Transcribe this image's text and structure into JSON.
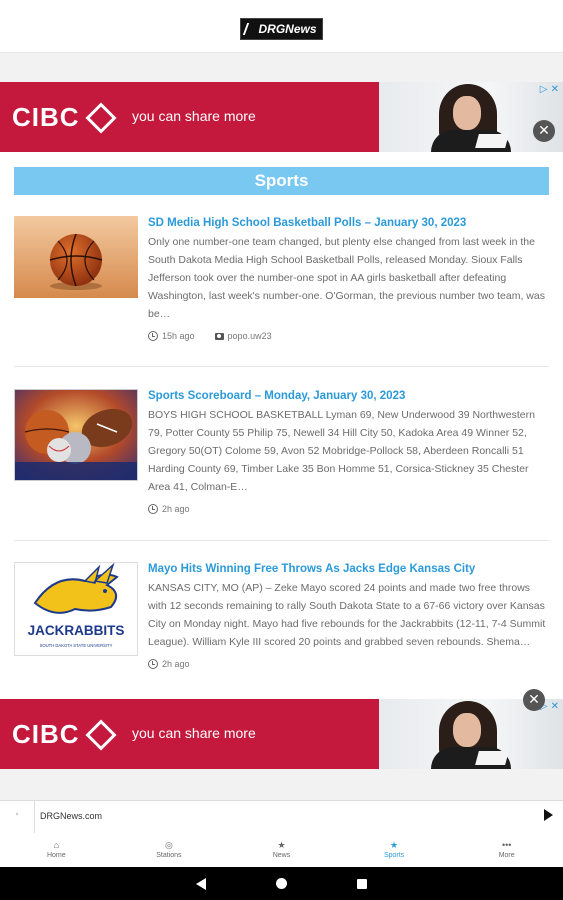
{
  "header": {
    "logo_text": "DRGNews"
  },
  "ads": {
    "brand": "CIBC",
    "tagline": "you can share more",
    "close_glyph": "✕",
    "choice_glyph": "▷ ✕"
  },
  "section": {
    "title": "Sports"
  },
  "articles": [
    {
      "title": "SD Media High School Basketball Polls – January 30, 2023",
      "excerpt": "Only one number-one team changed, but plenty else changed from last week in the South Dakota Media High School Basketball Polls, released Monday. Sioux Falls Jefferson took over the number-one spot in AA girls basketball after defeating Washington, last week's number-one. O'Gorman, the previous number two team, was be…",
      "time": "15h ago",
      "photo_credit": "popo.uw23",
      "thumb": "basketball-icon"
    },
    {
      "title": "Sports Scoreboard – Monday, January 30, 2023",
      "excerpt": "BOYS HIGH SCHOOL BASKETBALL Lyman 69, New Underwood 39 Northwestern 79, Potter County 55 Philip 75, Newell 34 Hill City 50, Kadoka Area 49 Winner 52, Gregory 50(OT) Colome 59, Avon 52 Mobridge-Pollock 58, Aberdeen Roncalli 51 Harding County 69, Timber Lake 35 Bon Homme 51, Corsica-Stickney 35 Chester Area 41, Colman-E…",
      "time": "2h ago",
      "thumb": "sports-balls-icon"
    },
    {
      "title": "Mayo Hits Winning Free Throws As Jacks Edge Kansas City",
      "excerpt": "KANSAS CITY, MO (AP) – Zeke Mayo scored 24 points and made two free throws with 12 seconds remaining to rally South Dakota State to a 67-66 victory over Kansas City on Monday night. Mayo had five rebounds for the Jackrabbits (12-11, 7-4 Summit League). William Kyle III scored 20 points and grabbed seven rebounds. Shema…",
      "time": "2h ago",
      "thumb_text": "JACKRABBITS",
      "thumb_subtext": "SOUTH DAKOTA STATE UNIVERSITY"
    }
  ],
  "player": {
    "left_label": "ʼ",
    "site": "DRGNews.com"
  },
  "bottom_nav": [
    {
      "label": "Home",
      "glyph": "⌂"
    },
    {
      "label": "Stations",
      "glyph": "◎"
    },
    {
      "label": "News",
      "glyph": "★"
    },
    {
      "label": "Sports",
      "glyph": "★",
      "active": true
    },
    {
      "label": "More",
      "glyph": "•••"
    }
  ],
  "colors": {
    "accent": "#2b9ad9",
    "section_bar": "#79c8f2",
    "ad_red": "#c4183c"
  }
}
